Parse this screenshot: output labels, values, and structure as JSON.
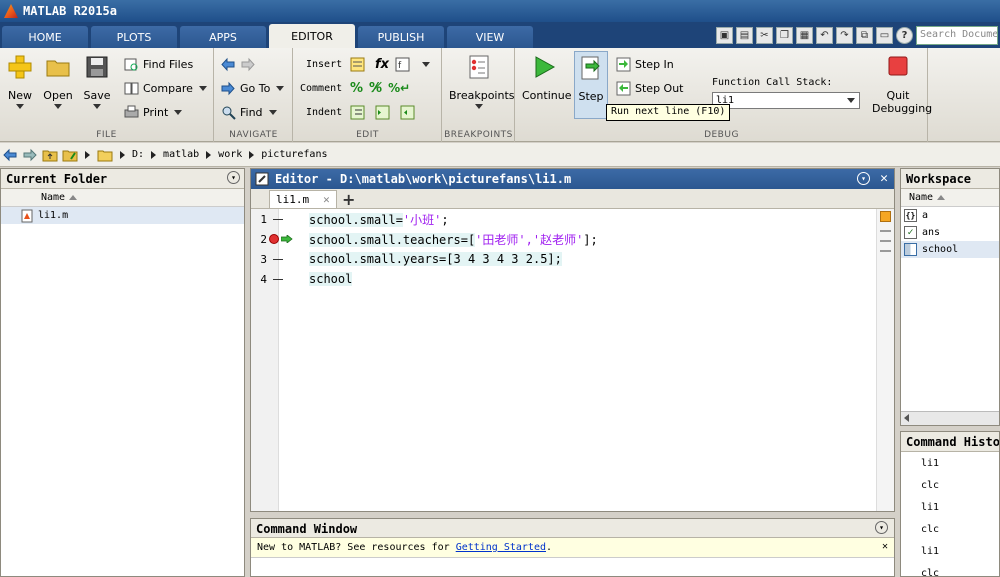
{
  "window": {
    "title": "MATLAB R2015a"
  },
  "tabs": [
    "HOME",
    "PLOTS",
    "APPS",
    "EDITOR",
    "PUBLISH",
    "VIEW"
  ],
  "search": {
    "placeholder": "Search Documentation"
  },
  "ribbon": {
    "file": {
      "label": "FILE",
      "new": "New",
      "open": "Open",
      "save": "Save",
      "find_files": "Find Files",
      "compare": "Compare",
      "print": "Print"
    },
    "navigate": {
      "label": "NAVIGATE",
      "go_to": "Go To",
      "find": "Find"
    },
    "edit": {
      "label": "EDIT",
      "insert": "Insert",
      "comment": "Comment",
      "indent": "Indent"
    },
    "breakpoints": {
      "label": "BREAKPOINTS",
      "button": "Breakpoints"
    },
    "debug": {
      "label": "DEBUG",
      "continue": "Continue",
      "step": "Step",
      "step_in": "Step In",
      "step_out": "Step Out",
      "call_stack_label": "Function Call Stack:",
      "call_stack_value": "li1",
      "quit": "Quit",
      "quit2": "Debugging"
    }
  },
  "tooltip": "Run next line (F10)",
  "path": [
    "D:",
    "matlab",
    "work",
    "picturefans"
  ],
  "current_folder": {
    "title": "Current Folder",
    "column": "Name",
    "files": [
      "li1.m"
    ]
  },
  "editor": {
    "title": "Editor - D:\\matlab\\work\\picturefans\\li1.m",
    "tab": "li1.m",
    "lines": [
      {
        "n": "1",
        "pre": "school.small=",
        "str": "'小班'",
        "post": ";"
      },
      {
        "n": "2",
        "pre": "school.small.teachers=[",
        "str": "'田老师','赵老师'",
        "post": "];"
      },
      {
        "n": "3",
        "pre": "school.small.years=[3 4 3 4 3 2.5];",
        "str": "",
        "post": ""
      },
      {
        "n": "4",
        "pre": "school",
        "str": "",
        "post": ""
      }
    ]
  },
  "workspace": {
    "title": "Workspace",
    "column": "Name",
    "vars": [
      "a",
      "ans",
      "school"
    ]
  },
  "command_window": {
    "title": "Command Window",
    "msg": "New to MATLAB? See resources for ",
    "link": "Getting Started",
    "msg_end": "."
  },
  "history": {
    "title": "Command History",
    "entries": [
      "li1",
      "clc",
      "li1",
      "clc",
      "li1",
      "clc"
    ]
  },
  "colors": {
    "accent": "#2b5790",
    "string": "#a020f0",
    "breakpoint": "#e03030",
    "continue": "#3cb83c"
  }
}
